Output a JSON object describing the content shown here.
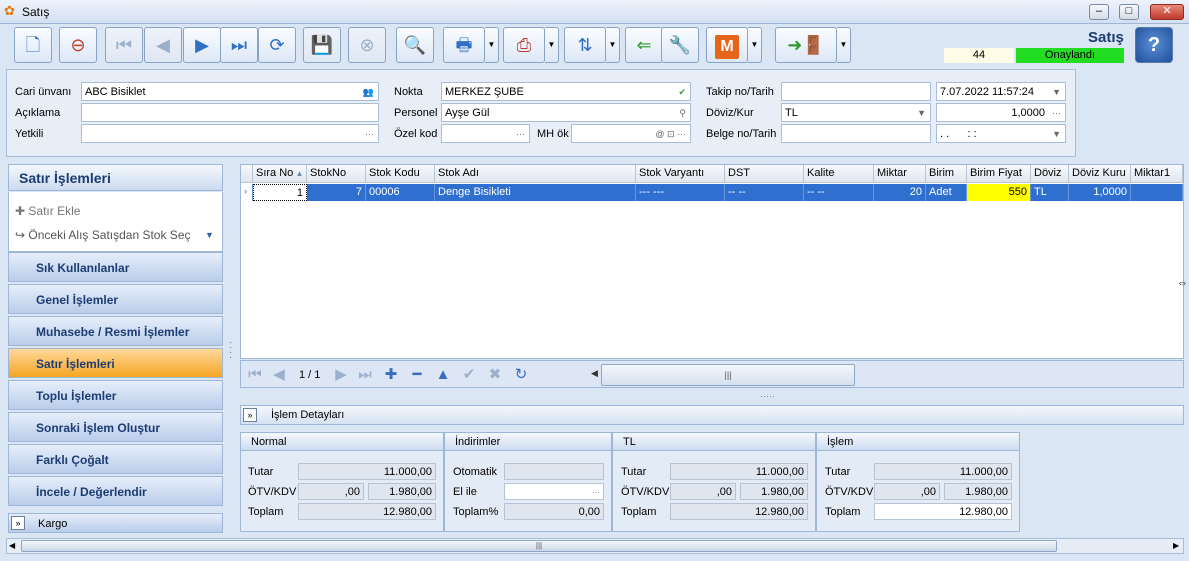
{
  "window": {
    "title": "Satış"
  },
  "header": {
    "title": "Satış",
    "record_count": "44",
    "status": "Onaylandı",
    "status_color": "#22dd22"
  },
  "form": {
    "cari_label": "Cari ünvanı",
    "cari_value": "ABC Bisiklet",
    "aciklama_label": "Açıklama",
    "aciklama_value": "",
    "yetkili_label": "Yetkili",
    "yetkili_value": "",
    "nokta_label": "Nokta",
    "nokta_value": "MERKEZ ŞUBE",
    "personel_label": "Personel",
    "personel_value": "Ayşe Gül",
    "ozelkod_label": "Özel kod",
    "ozelkod_value": "",
    "mhok_label": "MH ök",
    "mhok_value": "",
    "takip_label": "Takip no/Tarih",
    "takip_value": "",
    "takip_date": "7.07.2022 11:57:24",
    "doviz_label": "Döviz/Kur",
    "doviz_value": "TL",
    "kur_value": "1,0000",
    "belge_label": "Belge no/Tarih",
    "belge_value": "",
    "belge_date": ". .      : :"
  },
  "sidebar": {
    "title": "Satır İşlemleri",
    "tasks": [
      "Satır Ekle",
      "Önceki Alış Satışdan Stok Seç"
    ],
    "items": [
      {
        "label": "Sık Kullanılanlar"
      },
      {
        "label": "Genel İşlemler"
      },
      {
        "label": "Muhasebe / Resmi İşlemler"
      },
      {
        "label": "Satır İşlemleri"
      },
      {
        "label": "Toplu İşlemler"
      },
      {
        "label": "Sonraki İşlem Oluştur"
      },
      {
        "label": "Farklı Çoğalt"
      },
      {
        "label": "İncele / Değerlendir"
      }
    ],
    "footer": "Kargo"
  },
  "grid": {
    "columns": [
      "Sıra No",
      "StokNo",
      "Stok Kodu",
      "Stok Adı",
      "Stok Varyantı",
      "DST",
      "Kalite",
      "Miktar",
      "Birim",
      "Birim Fiyat",
      "Döviz",
      "Döviz Kuru",
      "Miktar1"
    ],
    "row": {
      "sira": "1",
      "stokno": "7",
      "kod": "00006",
      "ad": "Denge Bisikleti",
      "varyant": "--- ---",
      "dst": "-- --",
      "kalite": "-- --",
      "miktar": "20",
      "birim": "Adet",
      "fiyat": "550",
      "doviz": "TL",
      "kur": "1,0000",
      "miktar1": ""
    },
    "pager": "1 / 1"
  },
  "details": {
    "section_title": "İşlem Detayları",
    "normal": {
      "title": "Normal",
      "tutar_label": "Tutar",
      "tutar": "11.000,00",
      "otv_label": "ÖTV/KDV",
      "otv": ",00",
      "kdv": "1.980,00",
      "toplam_label": "Toplam",
      "toplam": "12.980,00"
    },
    "indirimler": {
      "title": "İndirimler",
      "otomatik_label": "Otomatik",
      "otomatik": "",
      "elile_label": "El ile",
      "elile": "",
      "toplam_label": "Toplam%",
      "toplam": "0,00"
    },
    "tl": {
      "title": "TL",
      "tutar_label": "Tutar",
      "tutar": "11.000,00",
      "otv_label": "ÖTV/KDV",
      "otv": ",00",
      "kdv": "1.980,00",
      "toplam_label": "Toplam",
      "toplam": "12.980,00"
    },
    "islem": {
      "title": "İşlem",
      "tutar_label": "Tutar",
      "tutar": "11.000,00",
      "otv_label": "ÖTV/KDV",
      "otv": ",00",
      "kdv": "1.980,00",
      "toplam_label": "Toplam",
      "toplam": "12.980,00"
    }
  }
}
